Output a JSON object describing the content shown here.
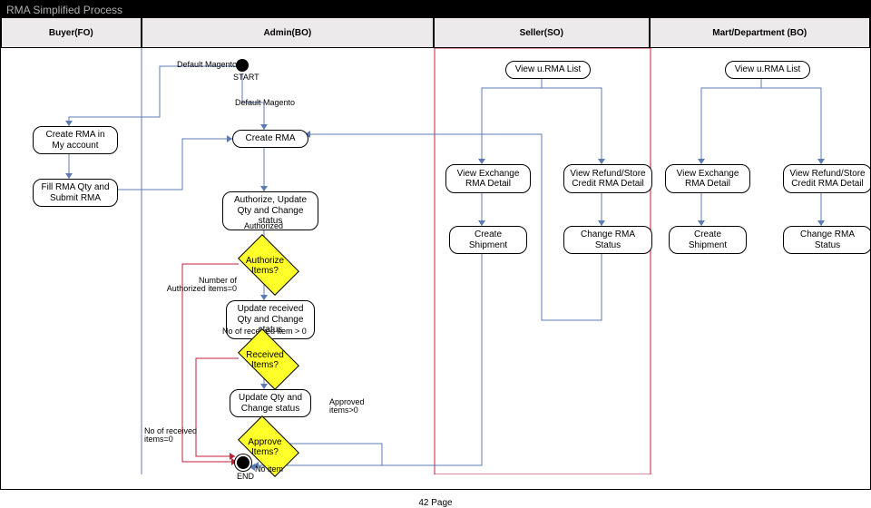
{
  "title": "RMA Simplified Process",
  "lanes": {
    "buyer": "Buyer(FO)",
    "admin": "Admin(BO)",
    "seller": "Seller(SO)",
    "mart": "Mart/Department (BO)"
  },
  "labels": {
    "start": "START",
    "end": "END",
    "default_mag": "Default Magento",
    "default_mag2": "Default Magento",
    "create_rma_myacct": "Create RMA in My account",
    "fill_submit": "Fill RMA Qty and Submit RMA",
    "create_rma": "Create RMA",
    "auth_update": "Authorize, Update Qty and Change status",
    "authorized": "Authorized",
    "auth_items": "Authorize Items?",
    "num_auth0": "Number of Authorized items=0",
    "update_recv": "Update received Qty and Change status",
    "recv_gt0": "No of received item > 0",
    "recv_items": "Received Items?",
    "update_qty": "Update Qty and Change status",
    "approved_gt0": "Approved items>0",
    "no_recv0": "No of received items=0",
    "approve_items": "Approve Items?",
    "no_item": "No item",
    "view_rma_list_s": "View u.RMA List",
    "view_rma_list_m": "View u.RMA List",
    "view_exch_s": "View Exchange RMA Detail",
    "view_refund_s": "View Refund/Store Credit RMA Detail",
    "view_exch_m": "View Exchange RMA Detail",
    "view_refund_m": "View Refund/Store Credit RMA Detail",
    "create_ship_s": "Create Shipment",
    "change_status_s": "Change RMA Status",
    "create_ship_m": "Create Shipment",
    "change_status_m": "Change RMA Status"
  },
  "footer": "42  Page"
}
